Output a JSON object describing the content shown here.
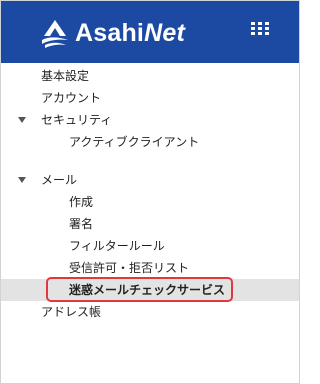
{
  "header": {
    "brand_main": "Asahi",
    "brand_accent": "Net",
    "bg_color": "#1c4aa3",
    "logo_icon": "asahi-net-bird-icon",
    "menu_icon": "grid-menu-icon"
  },
  "menu": {
    "items": [
      {
        "label": "基本設定"
      },
      {
        "label": "アカウント"
      },
      {
        "label": "セキュリティ",
        "expanded": true
      },
      {
        "label": "アクティブクライアント"
      },
      {
        "label": "メール",
        "expanded": true
      },
      {
        "label": "作成"
      },
      {
        "label": "署名"
      },
      {
        "label": "フィルタールール"
      },
      {
        "label": "受信許可・拒否リスト"
      },
      {
        "label": "迷惑メールチェックサービス",
        "selected": true
      },
      {
        "label": "アドレス帳"
      }
    ]
  },
  "highlight_color": "#e0383f"
}
